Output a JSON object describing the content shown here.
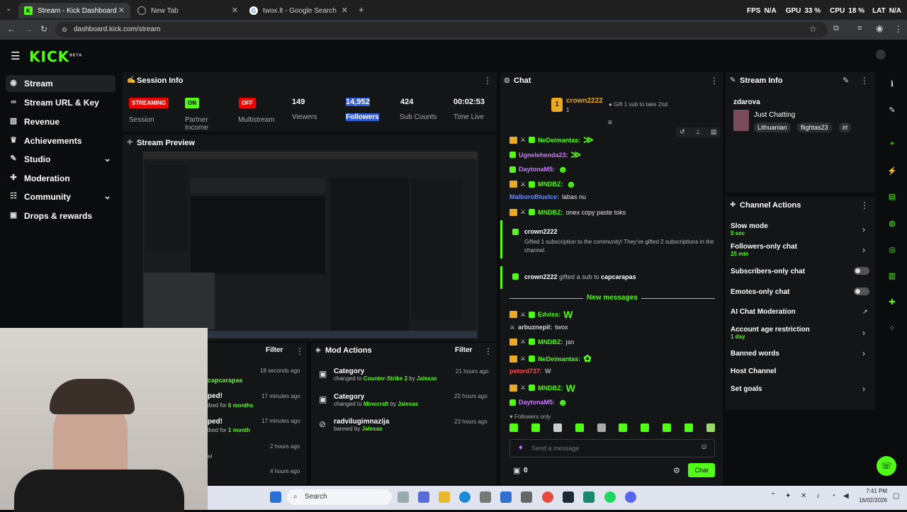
{
  "browser": {
    "tabs": [
      {
        "title": "Stream - Kick Dashboard",
        "active": true
      },
      {
        "title": "New Tab",
        "active": false
      },
      {
        "title": "twox.lt - Google Search",
        "active": false
      }
    ],
    "url": "dashboard.kick.com/stream",
    "overlay": {
      "fps_label": "FPS",
      "fps_value": "N/A",
      "gpu_label": "GPU",
      "gpu_value": "33 %",
      "cpu_label": "CPU",
      "cpu_value": "18 %",
      "lat_label": "LAT",
      "lat_value": "N/A"
    }
  },
  "kick": {
    "logo": "KICK",
    "beta": "BETA"
  },
  "sidebar": {
    "items": [
      {
        "label": "Stream",
        "icon": "stream-icon",
        "active": true
      },
      {
        "label": "Stream URL & Key",
        "icon": "link-icon"
      },
      {
        "label": "Revenue",
        "icon": "chart-icon"
      },
      {
        "label": "Achievements",
        "icon": "trophy-icon"
      },
      {
        "label": "Studio",
        "icon": "brush-icon",
        "expand": true
      },
      {
        "label": "Moderation",
        "icon": "wrench-icon"
      },
      {
        "label": "Community",
        "icon": "people-icon",
        "expand": true
      },
      {
        "label": "Drops & rewards",
        "icon": "gift-icon"
      }
    ]
  },
  "session": {
    "title": "Session Info",
    "session": {
      "badge": "STREAMING",
      "label": "Session"
    },
    "partner": {
      "badge": "ON",
      "label": "Partner Income"
    },
    "multistream": {
      "badge": "OFF",
      "label": "Multistream"
    },
    "viewers": {
      "value": "149",
      "label": "Viewers"
    },
    "followers": {
      "value": "14,952",
      "label": "Followers"
    },
    "subs": {
      "value": "424",
      "label": "Sub Counts"
    },
    "time": {
      "value": "00:02:53",
      "label": "Time Live"
    }
  },
  "preview": {
    "title": "Stream Preview"
  },
  "recent": {
    "filter": "Filter",
    "rows": [
      {
        "text": "capcarapas",
        "time": "18 seconds ago"
      },
      {
        "title": "ped!",
        "text": "ibed for ",
        "hl": "6 months",
        "time": "17 minutes ago"
      },
      {
        "title": "ped!",
        "text": "ibed for ",
        "hl": "1 month",
        "time": "17 minutes ago"
      },
      {
        "text": "",
        "time": "2 hours ago"
      },
      {
        "text": "el",
        "time": ""
      },
      {
        "text": "",
        "time": "4 hours ago"
      }
    ]
  },
  "mod_actions": {
    "title": "Mod Actions",
    "filter": "Filter",
    "rows": [
      {
        "title": "Category",
        "pre": "changed to ",
        "hl": "Counter-Strike 2",
        "by": " by ",
        "who": "Jalesas",
        "time": "21 hours ago"
      },
      {
        "title": "Category",
        "pre": "changed to ",
        "hl": "Minecraft",
        "by": " by ",
        "who": "Jalesas",
        "time": "22 hours ago"
      },
      {
        "title": "radvilugimnazija",
        "pre": "banned by ",
        "hl": "",
        "by": "",
        "who": "Jalesas",
        "time": "23 hours ago"
      }
    ]
  },
  "chat": {
    "title": "Chat",
    "pinned": {
      "rank": "1",
      "user": "crown2222",
      "count": "1",
      "gift_text": "Gift 1 sub to take 2nd"
    },
    "messages": [
      {
        "user": "NeDeimantas:",
        "color": "#53fc18",
        "text": "",
        "emote": "≫"
      },
      {
        "user": "Ugnelehenda23:",
        "color": "#c97bff",
        "text": "",
        "emote": "≫"
      },
      {
        "user": "DaytonaM5:",
        "color": "#c97bff",
        "text": "",
        "emote": "☻"
      },
      {
        "user": "MNDBZ:",
        "color": "#53fc18",
        "text": "",
        "emote": "☻"
      },
      {
        "user": "MalboroBluelce:",
        "color": "#6b8dff",
        "text": "labas nu",
        "emote": ""
      },
      {
        "user": "MNDBZ:",
        "color": "#53fc18",
        "text": "onex copy paste toks",
        "emote": ""
      }
    ],
    "gift1": {
      "user": "crown2222",
      "text": "Gifted 1 subscription to the community! They've gifted 2 subscriptions in the channel."
    },
    "gift2": {
      "user": "crown2222",
      "mid": "gifted a sub to",
      "target": "capcarapas"
    },
    "new_messages": "New messages",
    "messages2": [
      {
        "user": "Edviss:",
        "color": "#53fc18",
        "text": "",
        "emote": "W"
      },
      {
        "user": "arbuznepil:",
        "color": "#dddddd",
        "text": "twox",
        "emote": ""
      },
      {
        "user": "MNDBZ:",
        "color": "#53fc18",
        "text": "jsn",
        "emote": ""
      },
      {
        "user": "NeDeimantas:",
        "color": "#53fc18",
        "text": "",
        "emote": "✿"
      },
      {
        "user": "petord737:",
        "color": "#ff4a4a",
        "text": "W",
        "emote": ""
      },
      {
        "user": "MNDBZ:",
        "color": "#53fc18",
        "text": "",
        "emote": "W"
      },
      {
        "user": "DaytonaM5:",
        "color": "#c97bff",
        "text": "",
        "emote": "☻"
      }
    ],
    "followers_only": "Followers only",
    "placeholder": "Send a message",
    "points": "0",
    "send_label": "Chat"
  },
  "stream_info": {
    "title": "Stream Info",
    "user": "zdarova",
    "category": "Just Chatting",
    "tags": [
      "Lithuanian",
      "flightas23",
      "irl"
    ]
  },
  "channel_actions": {
    "title": "Channel Actions",
    "items": [
      {
        "label": "Slow mode",
        "sub": "5 sec"
      },
      {
        "label": "Followers-only chat",
        "sub": "25 min"
      },
      {
        "label": "Subscribers-only chat",
        "sub": ""
      },
      {
        "label": "Emotes-only chat",
        "sub": ""
      },
      {
        "label": "AI Chat Moderation",
        "sub": ""
      },
      {
        "label": "Account age restriction",
        "sub": "1 day"
      },
      {
        "label": "Banned words",
        "sub": ""
      },
      {
        "label": "Host Channel",
        "sub": ""
      },
      {
        "label": "Set goals",
        "sub": ""
      }
    ]
  },
  "taskbar": {
    "search": "Search",
    "time": "7:41 PM",
    "date": "16/02/2026"
  },
  "colors": {
    "accent": "#53fc18",
    "badge_red": "#eb0400",
    "panel": "#141517",
    "bg": "#0b0c0d"
  }
}
